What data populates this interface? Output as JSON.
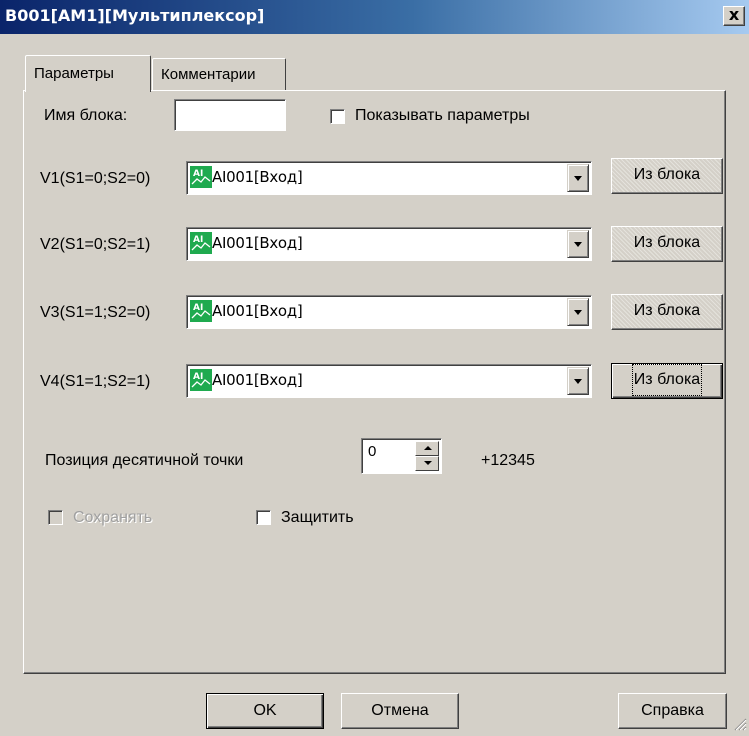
{
  "window": {
    "title": "B001[AM1][Мультиплексор]",
    "close_label": "x"
  },
  "tabs": [
    {
      "label": "Параметры",
      "active": true
    },
    {
      "label": "Комментарии",
      "active": false
    }
  ],
  "params": {
    "block_name_label": "Имя блока:",
    "block_name_value": "",
    "show_params_label": "Показывать параметры",
    "show_params_checked": false,
    "rows": [
      {
        "label": "V1(S1=0;S2=0)",
        "icon": "analog-input-icon",
        "icon_text": "AI",
        "value": "AI001[Вход]",
        "button": "Из блока"
      },
      {
        "label": "V2(S1=0;S2=1)",
        "icon": "analog-input-icon",
        "icon_text": "AI",
        "value": "AI001[Вход]",
        "button": "Из блока"
      },
      {
        "label": "V3(S1=1;S2=0)",
        "icon": "analog-input-icon",
        "icon_text": "AI",
        "value": "AI001[Вход]",
        "button": "Из блока"
      },
      {
        "label": "V4(S1=1;S2=1)",
        "icon": "analog-input-icon",
        "icon_text": "AI",
        "value": "AI001[Вход]",
        "button": "Из блока"
      }
    ],
    "decimal_label": "Позиция десятичной точки",
    "decimal_value": "0",
    "decimal_preview": "+12345",
    "retain_label": "Сохранять",
    "retain_checked": false,
    "retain_enabled": false,
    "protect_label": "Защитить",
    "protect_checked": false
  },
  "footer": {
    "ok_label": "OK",
    "cancel_label": "Отмена",
    "help_label": "Справка"
  },
  "colors": {
    "face": "#d4d0c8",
    "title_gradient_start": "#0a246a",
    "icon_green": "#1faa4f"
  }
}
